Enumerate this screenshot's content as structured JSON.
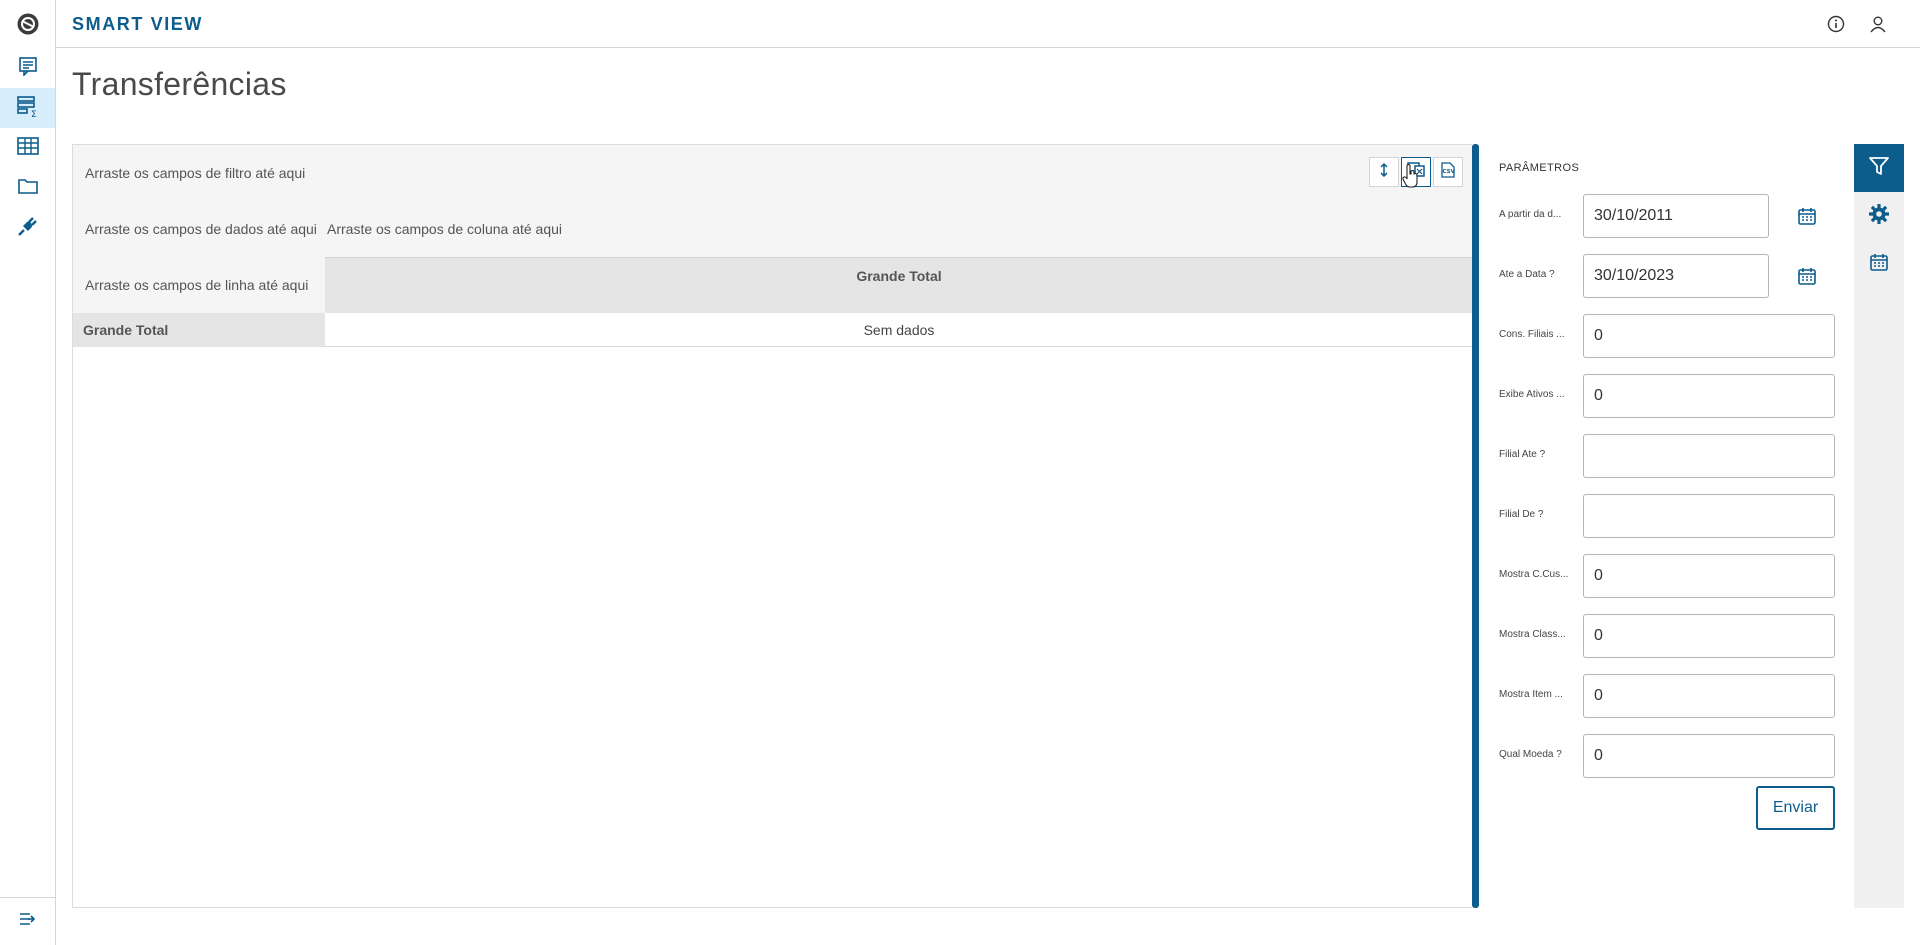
{
  "header": {
    "brand": "SMART VIEW"
  },
  "page": {
    "title": "Transferências"
  },
  "pivot": {
    "filter_zone": "Arraste os campos de filtro até aqui",
    "data_zone": "Arraste os campos de dados até aqui",
    "column_zone": "Arraste os campos de coluna até aqui",
    "row_zone": "Arraste os campos de linha até aqui",
    "column_total": "Grande Total",
    "row_total": "Grande Total",
    "empty_cell": "Sem dados"
  },
  "params": {
    "title": "PARÂMETROS",
    "fields": [
      {
        "label": "A partir da d...",
        "value": "30/10/2011"
      },
      {
        "label": "Ate a Data ?",
        "value": "30/10/2023"
      },
      {
        "label": "Cons. Filiais ...",
        "value": "0"
      },
      {
        "label": "Exibe Ativos ...",
        "value": "0"
      },
      {
        "label": "Filial Ate ?",
        "value": ""
      },
      {
        "label": "Filial De ?",
        "value": ""
      },
      {
        "label": "Mostra C.Cus...",
        "value": "0"
      },
      {
        "label": "Mostra Class...",
        "value": "0"
      },
      {
        "label": "Mostra Item ...",
        "value": "0"
      },
      {
        "label": "Qual Moeda ?",
        "value": "0"
      }
    ],
    "submit": "Enviar"
  },
  "colors": {
    "primary": "#0c5c8c",
    "active_nav": "#d6eefc"
  },
  "icons": {
    "rail": [
      "logo-icon",
      "report-icon",
      "pivot-icon",
      "table-icon",
      "folder-icon",
      "plug-icon",
      "expand-menu-icon"
    ],
    "header": [
      "info-icon",
      "user-icon"
    ],
    "pivot_tools": [
      "sort-icon",
      "export-excel-icon",
      "export-csv-icon"
    ],
    "right_toolbar": [
      "filter-icon",
      "gear-icon",
      "calendar-icon"
    ]
  }
}
